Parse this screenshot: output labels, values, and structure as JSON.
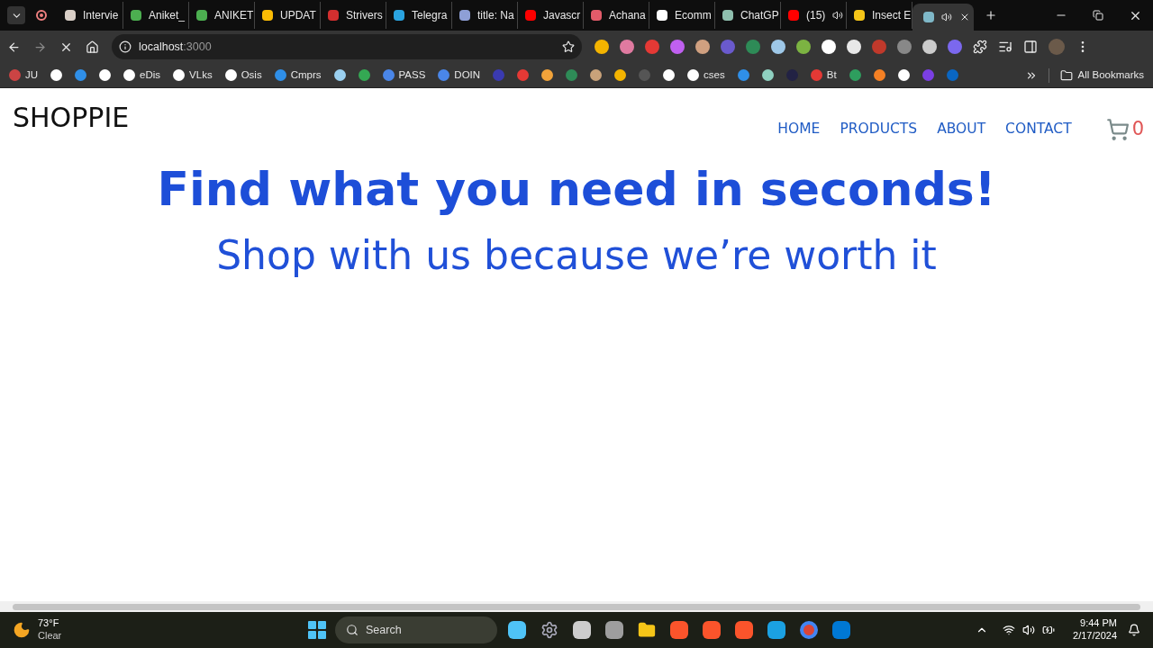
{
  "browser": {
    "tabs": [
      {
        "title": "Intervie",
        "color": "#d9cfc7",
        "selected": false,
        "audio": false
      },
      {
        "title": "Aniket_",
        "color": "#4caf50",
        "selected": false,
        "audio": false
      },
      {
        "title": "ANIKET",
        "color": "#4caf50",
        "selected": false,
        "audio": false
      },
      {
        "title": "UPDAT",
        "color": "#fbbc04",
        "selected": false,
        "audio": false
      },
      {
        "title": "Strivers",
        "color": "#d32f2f",
        "selected": false,
        "audio": false
      },
      {
        "title": "Telegra",
        "color": "#2aa3e0",
        "selected": false,
        "audio": false
      },
      {
        "title": "title: Na",
        "color": "#8e9fd6",
        "selected": false,
        "audio": false
      },
      {
        "title": "Javascr",
        "color": "#ff0000",
        "selected": false,
        "audio": false
      },
      {
        "title": "Achana",
        "color": "#e25b6a",
        "selected": false,
        "audio": false
      },
      {
        "title": "Ecomm",
        "color": "#ffffff",
        "selected": false,
        "audio": false
      },
      {
        "title": "ChatGP",
        "color": "#8fbfae",
        "selected": false,
        "audio": false
      },
      {
        "title": "(15)",
        "color": "#ff0000",
        "selected": false,
        "audio": true
      },
      {
        "title": "Insect E",
        "color": "#f5c518",
        "selected": false,
        "audio": false
      },
      {
        "color": "#7fb8c8",
        "selected": true,
        "audio": true
      }
    ],
    "address": {
      "host": "localhost",
      "port": ":3000"
    },
    "bookmarks": [
      {
        "label": "JU",
        "color": "#c44"
      },
      {
        "color": "#ffffff"
      },
      {
        "color": "#2f8fe8"
      },
      {
        "color": "#ffffff"
      },
      {
        "label": "eDis",
        "color": "#ffffff"
      },
      {
        "label": "VLks",
        "color": "#ffffff"
      },
      {
        "label": "Osis",
        "color": "#ffffff"
      },
      {
        "label": "Cmprs",
        "color": "#2f8fe8"
      },
      {
        "color": "#9ad0f0"
      },
      {
        "color": "#34a853"
      },
      {
        "label": "PASS",
        "color": "#4a86e8"
      },
      {
        "label": "DOIN",
        "color": "#4a86e8"
      },
      {
        "color": "#3a3ab0"
      },
      {
        "color": "#e53935"
      },
      {
        "color": "#f2a33a"
      },
      {
        "color": "#2e8b57"
      },
      {
        "color": "#c9a27a"
      },
      {
        "color": "#f4b400"
      },
      {
        "color": "#555555"
      },
      {
        "color": "#ffffff"
      },
      {
        "label": "cses",
        "color": "#ffffff"
      },
      {
        "color": "#2f8fe8"
      },
      {
        "color": "#8fd0c0"
      },
      {
        "color": "#222244"
      },
      {
        "label": "Bt",
        "color": "#e53935"
      },
      {
        "color": "#2e9e5e"
      },
      {
        "color": "#f48024"
      },
      {
        "color": "#ffffff"
      },
      {
        "color": "#7b3fe4"
      },
      {
        "color": "#0a66c2"
      }
    ],
    "all_bookmarks": "All Bookmarks"
  },
  "page": {
    "logo": "SHOPPIE",
    "nav": [
      "HOME",
      "PRODUCTS",
      "ABOUT",
      "CONTACT"
    ],
    "cart_count": "0",
    "headline": "Find what you need in seconds!",
    "subheadline": "Shop with us because we’re worth it"
  },
  "taskbar": {
    "temperature": "73°F",
    "weather": "Clear",
    "search_placeholder": "Search",
    "time": "9:44 PM",
    "date": "2/17/2024"
  }
}
